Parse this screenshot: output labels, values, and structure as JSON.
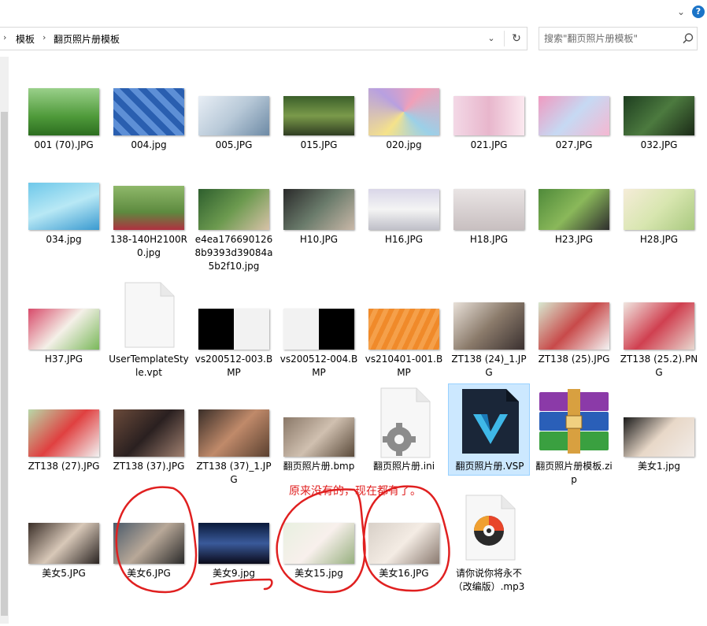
{
  "breadcrumb": {
    "parent": "模板",
    "current": "翻页照片册模板"
  },
  "search": {
    "placeholder": "搜索\"翻页照片册模板\""
  },
  "annotation": "原来没有的，现在都有了。",
  "files": [
    {
      "id": "f1",
      "name": "001 (70).JPG",
      "icon": "image-thumbnail"
    },
    {
      "id": "f2",
      "name": "004.jpg",
      "icon": "image-thumbnail"
    },
    {
      "id": "f3",
      "name": "005.JPG",
      "icon": "image-thumbnail"
    },
    {
      "id": "f4",
      "name": "015.JPG",
      "icon": "image-thumbnail"
    },
    {
      "id": "f5",
      "name": "020.jpg",
      "icon": "image-thumbnail"
    },
    {
      "id": "f6",
      "name": "021.JPG",
      "icon": "image-thumbnail"
    },
    {
      "id": "f7",
      "name": "027.JPG",
      "icon": "image-thumbnail"
    },
    {
      "id": "f8",
      "name": "032.JPG",
      "icon": "image-thumbnail"
    },
    {
      "id": "f9",
      "name": "034.jpg",
      "icon": "image-thumbnail"
    },
    {
      "id": "f10",
      "name": "138-140H2100R0.jpg",
      "icon": "image-thumbnail"
    },
    {
      "id": "f11",
      "name": "e4ea1766901268b9393d39084a5b2f10.jpg",
      "icon": "image-thumbnail"
    },
    {
      "id": "f12",
      "name": "H10.JPG",
      "icon": "image-thumbnail"
    },
    {
      "id": "f13",
      "name": "H16.JPG",
      "icon": "image-thumbnail"
    },
    {
      "id": "f14",
      "name": "H18.JPG",
      "icon": "image-thumbnail"
    },
    {
      "id": "f15",
      "name": "H23.JPG",
      "icon": "image-thumbnail"
    },
    {
      "id": "f16",
      "name": "H28.JPG",
      "icon": "image-thumbnail"
    },
    {
      "id": "f17",
      "name": "H37.JPG",
      "icon": "image-thumbnail"
    },
    {
      "id": "f18",
      "name": "UserTemplateStyle.vpt",
      "icon": "blank-document-icon"
    },
    {
      "id": "f19",
      "name": "vs200512-003.BMP",
      "icon": "image-thumbnail"
    },
    {
      "id": "f20",
      "name": "vs200512-004.BMP",
      "icon": "image-thumbnail"
    },
    {
      "id": "f21",
      "name": "vs210401-001.BMP",
      "icon": "image-thumbnail"
    },
    {
      "id": "f22",
      "name": "ZT138 (24)_1.JPG",
      "icon": "image-thumbnail"
    },
    {
      "id": "f23",
      "name": "ZT138 (25).JPG",
      "icon": "image-thumbnail"
    },
    {
      "id": "f24",
      "name": "ZT138 (25.2).PNG",
      "icon": "image-thumbnail"
    },
    {
      "id": "f25",
      "name": "ZT138 (27).JPG",
      "icon": "image-thumbnail"
    },
    {
      "id": "f26",
      "name": "ZT138 (37).JPG",
      "icon": "image-thumbnail"
    },
    {
      "id": "f27",
      "name": "ZT138 (37)_1.JPG",
      "icon": "image-thumbnail"
    },
    {
      "id": "f28",
      "name": "翻页照片册.bmp",
      "icon": "image-thumbnail"
    },
    {
      "id": "f29",
      "name": "翻页照片册.ini",
      "icon": "settings-file-icon"
    },
    {
      "id": "f30",
      "name": "翻页照片册.VSP",
      "icon": "vsp-app-icon"
    },
    {
      "id": "f31",
      "name": "翻页照片册模板.zip",
      "icon": "winrar-archive-icon"
    },
    {
      "id": "f32",
      "name": "美女1.jpg",
      "icon": "image-thumbnail"
    },
    {
      "id": "f33",
      "name": "美女5.JPG",
      "icon": "image-thumbnail"
    },
    {
      "id": "f34",
      "name": "美女6.JPG",
      "icon": "image-thumbnail"
    },
    {
      "id": "f35",
      "name": "美女9.jpg",
      "icon": "image-thumbnail"
    },
    {
      "id": "f36",
      "name": "美女15.jpg",
      "icon": "image-thumbnail"
    },
    {
      "id": "f37",
      "name": "美女16.JPG",
      "icon": "image-thumbnail"
    },
    {
      "id": "f38",
      "name": "请你说你将永不（改编版）.mp3",
      "icon": "music-file-icon"
    }
  ]
}
